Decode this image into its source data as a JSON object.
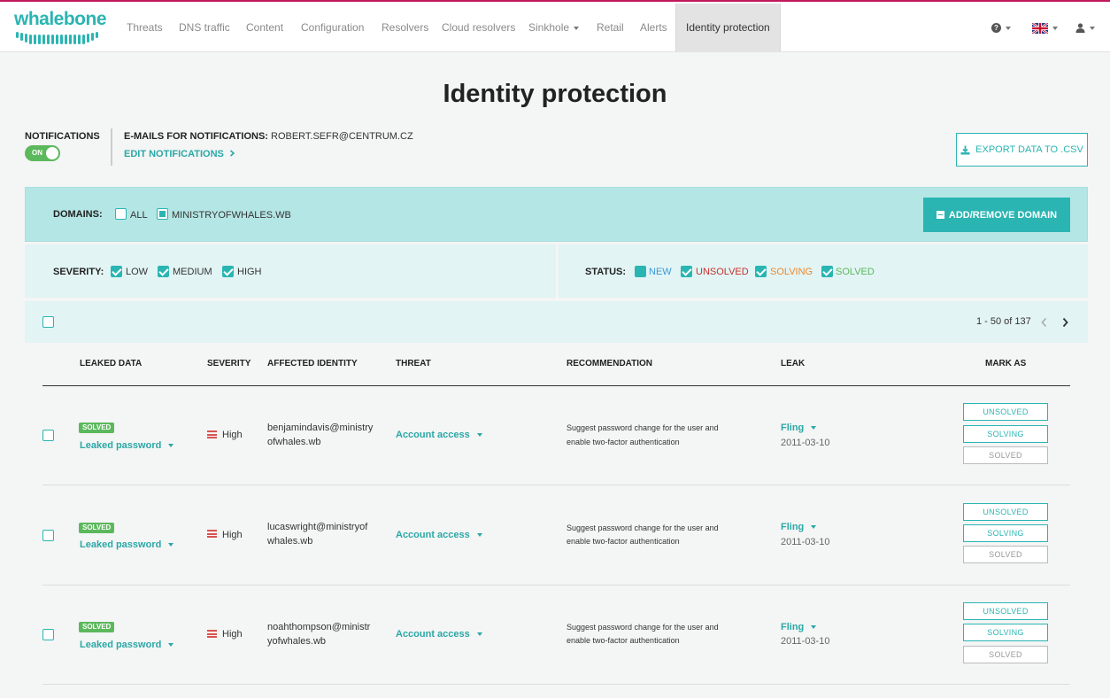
{
  "brand": {
    "name": "whalebone"
  },
  "nav": {
    "items": [
      "Threats",
      "DNS traffic",
      "Content",
      "Configuration",
      "Resolvers",
      "Cloud resolvers",
      "Sinkhole",
      "Retail",
      "Alerts",
      "Identity protection"
    ],
    "active": "Identity protection"
  },
  "page": {
    "title": "Identity protection"
  },
  "notifications": {
    "label": "NOTIFICATIONS",
    "toggle": "ON",
    "emails_label": "E-MAILS FOR NOTIFICATIONS:",
    "emails_value": "ROBERT.SEFR@CENTRUM.CZ",
    "edit_link": "EDIT NOTIFICATIONS"
  },
  "export_button": "EXPORT DATA TO .CSV",
  "filters": {
    "domains_label": "DOMAINS:",
    "domain_all": "ALL",
    "domain_item": "MINISTRYOFWHALES.WB",
    "add_remove_button": "ADD/REMOVE DOMAIN",
    "severity_label": "SEVERITY:",
    "severity_options": [
      "LOW",
      "MEDIUM",
      "HIGH"
    ],
    "status_label": "STATUS:",
    "status_options": [
      "NEW",
      "UNSOLVED",
      "SOLVING",
      "SOLVED"
    ]
  },
  "pagination": {
    "text": "1 - 50 of 137"
  },
  "table": {
    "columns": [
      "LEAKED DATA",
      "SEVERITY",
      "AFFECTED IDENTITY",
      "THREAT",
      "RECOMMENDATION",
      "LEAK",
      "MARK AS"
    ],
    "mark_as_options": [
      "UNSOLVED",
      "SOLVING",
      "SOLVED"
    ],
    "rows": [
      {
        "status": "SOLVED",
        "leaked": "Leaked password",
        "severity": "High",
        "identity_1": "benjamindavis@ministry",
        "identity_2": "ofwhales.wb",
        "threat": "Account access",
        "rec_1": "Suggest password change for the user and",
        "rec_2": "enable two-factor authentication",
        "leak": "Fling",
        "date": "2011-03-10"
      },
      {
        "status": "SOLVED",
        "leaked": "Leaked password",
        "severity": "High",
        "identity_1": "lucaswright@ministryof",
        "identity_2": "whales.wb",
        "threat": "Account access",
        "rec_1": "Suggest password change for the user and",
        "rec_2": "enable two-factor authentication",
        "leak": "Fling",
        "date": "2011-03-10"
      },
      {
        "status": "SOLVED",
        "leaked": "Leaked password",
        "severity": "High",
        "identity_1": "noahthompson@ministr",
        "identity_2": "yofwhales.wb",
        "threat": "Account access",
        "rec_1": "Suggest password change for the user and",
        "rec_2": "enable two-factor authentication",
        "leak": "Fling",
        "date": "2011-03-10"
      }
    ]
  },
  "colors": {
    "accent": "#2ab5b2",
    "solved": "#5cb85c",
    "unsolved": "#c9302c",
    "solving": "#f0882a",
    "new": "#3a9ad9",
    "high": "#d9534f"
  }
}
